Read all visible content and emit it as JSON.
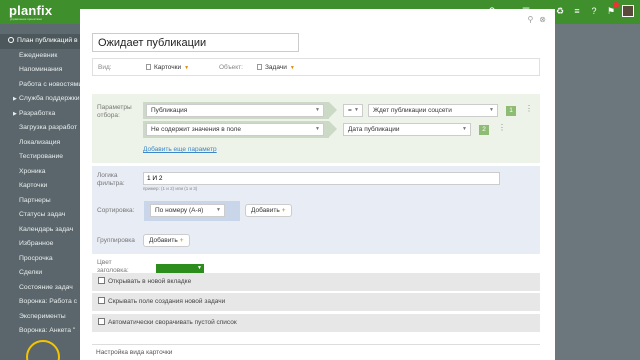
{
  "app": {
    "logo": "planfix",
    "logo_sub": "управление проектами"
  },
  "topbar": {
    "icons": [
      "search-icon",
      "dropdown-icon",
      "list-icon",
      "dropdown-icon",
      "tree-icon",
      "menu-icon",
      "help-icon",
      "bell-icon",
      "avatar"
    ]
  },
  "sidebar": {
    "items": [
      {
        "label": "План публикаций в",
        "type": "active"
      },
      {
        "label": "Ежедневник",
        "type": "item"
      },
      {
        "label": "Напоминания",
        "type": "item"
      },
      {
        "label": "Работа с новостями",
        "type": "item"
      },
      {
        "label": "Служба поддержки",
        "type": "group"
      },
      {
        "label": "Разработка",
        "type": "group"
      },
      {
        "label": "Загрузка разработ",
        "type": "item"
      },
      {
        "label": "Локализация",
        "type": "item"
      },
      {
        "label": "Тестирование",
        "type": "item"
      },
      {
        "label": "Хроника",
        "type": "item"
      },
      {
        "label": "Карточки",
        "type": "item"
      },
      {
        "label": "Партнеры",
        "type": "item"
      },
      {
        "label": "Статусы задач",
        "type": "item"
      },
      {
        "label": "Календарь задач",
        "type": "item"
      },
      {
        "label": "Избранное",
        "type": "item"
      },
      {
        "label": "Просрочка",
        "type": "item"
      },
      {
        "label": "Сделки",
        "type": "item"
      },
      {
        "label": "Состояние задач",
        "type": "item"
      },
      {
        "label": "Воронка: Работа с",
        "type": "item"
      },
      {
        "label": "Эксперименты",
        "type": "item"
      },
      {
        "label": "Воронка: Анкета \"",
        "type": "item"
      }
    ]
  },
  "modal": {
    "title_value": "Ожидает публикации",
    "view_label": "Вид:",
    "view_value": "Карточки",
    "object_label": "Объект:",
    "object_value": "Задачи",
    "filter": {
      "label": "Параметры отбора:",
      "rows": [
        {
          "field": "Публикация",
          "operator": "=",
          "value": "Ждет публикации соцсети",
          "index": "1"
        },
        {
          "field": "Не содержит значения в поле",
          "operator": "",
          "value": "Дата публикации",
          "index": "2"
        }
      ],
      "add_link": "Добавить еще параметр"
    },
    "logic": {
      "label": "Логика фильтра:",
      "value": "1 И 2",
      "hint": "пример: (1 и 2) или (1 и 3)"
    },
    "sort": {
      "label": "Сортировка:",
      "value": "По номеру (А-я)",
      "add": "Добавить"
    },
    "group": {
      "label": "Группировка",
      "add": "Добавить"
    },
    "header_color": {
      "label": "Цвет заголовка:",
      "color": "#2c8c1c"
    },
    "checks": [
      {
        "label": "Открывать в новой вкладке",
        "checked": false
      },
      {
        "label": "Скрывать поле создания новой задачи",
        "checked": false
      },
      {
        "label": "Автоматически сворачивать пустой список",
        "checked": false
      }
    ],
    "view_settings": "Настройка вида карточки"
  }
}
